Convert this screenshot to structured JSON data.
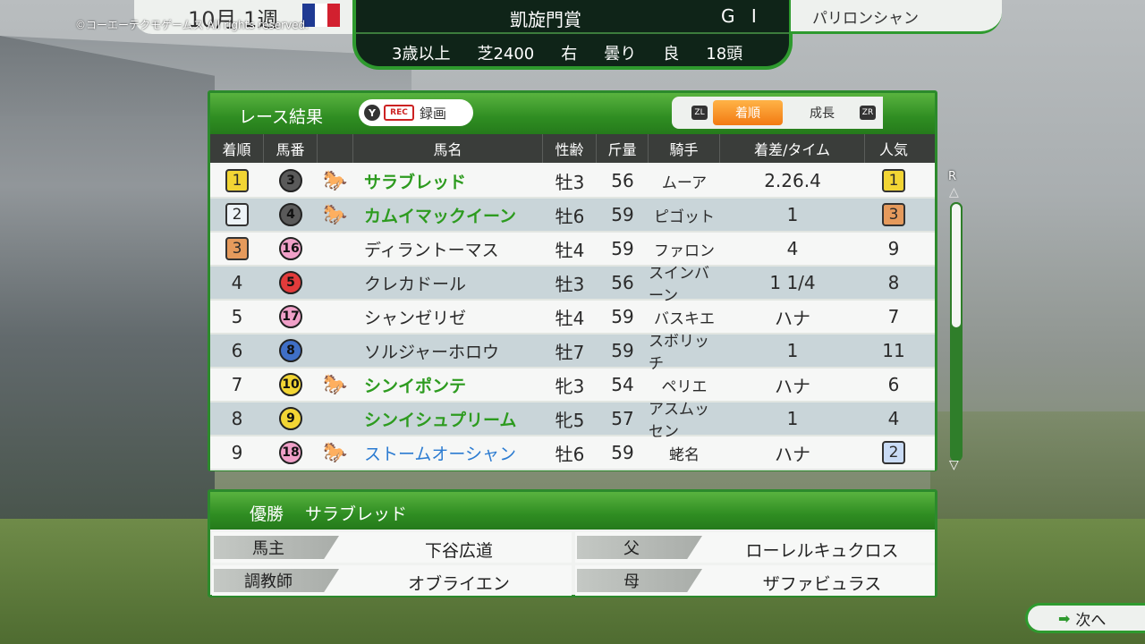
{
  "copyright": "©コーエーテクモゲームス All rights reserved.",
  "date": "10月 1週",
  "flag_colors": [
    "#1f3a93",
    "#ffffff",
    "#d2202f"
  ],
  "race": {
    "name": "凱旋門賞",
    "grade": "G I",
    "details": [
      "3歳以上",
      "芝2400",
      "右",
      "曇り",
      "良",
      "18頭"
    ]
  },
  "venue": "パリロンシャン",
  "results": {
    "title": "レース結果",
    "rec_button": {
      "y": "Y",
      "rec": "REC",
      "label": "録画"
    },
    "tabs": {
      "zl": "ZL",
      "zr": "ZR",
      "order": "着順",
      "growth": "成長"
    },
    "columns": [
      "着順",
      "馬番",
      "馬名",
      "性齢",
      "斤量",
      "騎手",
      "着差/タイム",
      "人気"
    ],
    "rows": [
      {
        "rank": "1",
        "rank_color": "#f2d534",
        "num": "3",
        "gate_color": "#5a5a5a",
        "icon": "🐎",
        "name": "サラブレッド",
        "name_style": "green",
        "sex": "牡3",
        "weight": "56",
        "jockey": "ムーア",
        "margin": "2.26.4",
        "pop": "1",
        "pop_color": "#f2d534"
      },
      {
        "rank": "2",
        "rank_color": "#eef4f8",
        "num": "4",
        "gate_color": "#5a5a5a",
        "icon": "🐎",
        "name": "カムイマックイーン",
        "name_style": "green",
        "sex": "牡6",
        "weight": "59",
        "jockey": "ピゴット",
        "margin": "1",
        "pop": "3",
        "pop_color": "#e59a5c"
      },
      {
        "rank": "3",
        "rank_color": "#e59a5c",
        "num": "16",
        "gate_color": "#f0a0c8",
        "icon": "",
        "name": "ディラントーマス",
        "name_style": "plain",
        "sex": "牡4",
        "weight": "59",
        "jockey": "ファロン",
        "margin": "4",
        "pop": "9",
        "pop_color": ""
      },
      {
        "rank": "4",
        "rank_color": "",
        "num": "5",
        "gate_color": "#e23b3b",
        "icon": "",
        "name": "クレカドール",
        "name_style": "plain",
        "sex": "牡3",
        "weight": "56",
        "jockey": "スインバーン",
        "margin": "1 1/4",
        "pop": "8",
        "pop_color": ""
      },
      {
        "rank": "5",
        "rank_color": "",
        "num": "17",
        "gate_color": "#f0a0c8",
        "icon": "",
        "name": "シャンゼリゼ",
        "name_style": "plain",
        "sex": "牡4",
        "weight": "59",
        "jockey": "バスキエ",
        "margin": "ハナ",
        "pop": "7",
        "pop_color": ""
      },
      {
        "rank": "6",
        "rank_color": "",
        "num": "8",
        "gate_color": "#3f6fc7",
        "icon": "",
        "name": "ソルジャーホロウ",
        "name_style": "plain",
        "sex": "牡7",
        "weight": "59",
        "jockey": "スボリッチ",
        "margin": "1",
        "pop": "11",
        "pop_color": ""
      },
      {
        "rank": "7",
        "rank_color": "",
        "num": "10",
        "gate_color": "#f2d534",
        "icon": "🐎",
        "name": "シンイポンテ",
        "name_style": "green",
        "sex": "牝3",
        "weight": "54",
        "jockey": "ペリエ",
        "margin": "ハナ",
        "pop": "6",
        "pop_color": ""
      },
      {
        "rank": "8",
        "rank_color": "",
        "num": "9",
        "gate_color": "#f2d534",
        "icon": "",
        "name": "シンイシュプリーム",
        "name_style": "green",
        "sex": "牝5",
        "weight": "57",
        "jockey": "アスムッセン",
        "margin": "1",
        "pop": "4",
        "pop_color": ""
      },
      {
        "rank": "9",
        "rank_color": "",
        "num": "18",
        "gate_color": "#f0a0c8",
        "icon": "🐎",
        "name": "ストームオーシャン",
        "name_style": "blue",
        "sex": "牡6",
        "weight": "59",
        "jockey": "蛯名",
        "margin": "ハナ",
        "pop": "2",
        "pop_color": "#c9dbf5"
      }
    ]
  },
  "scroll": {
    "r_label": "R"
  },
  "winner": {
    "label": "優勝",
    "name": "サラブレッド",
    "owner_key": "馬主",
    "owner": "下谷広道",
    "sire_key": "父",
    "sire": "ローレルキュクロス",
    "trainer_key": "調教師",
    "trainer": "オブライエン",
    "dam_key": "母",
    "dam": "ザファビュラス"
  },
  "next": {
    "label": "次へ"
  }
}
